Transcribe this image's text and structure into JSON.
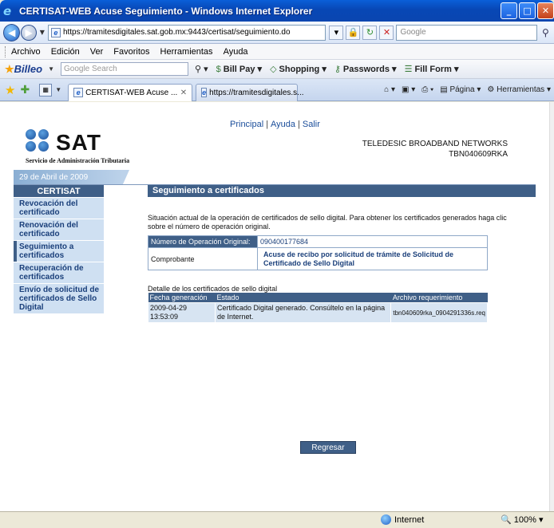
{
  "window": {
    "title": "CERTISAT-WEB Acuse Seguimiento - Windows Internet Explorer",
    "icon": "ie-icon"
  },
  "address": {
    "url": "https://tramitesdigitales.sat.gob.mx:9443/certisat/seguimiento.do",
    "search_placeholder": "Google"
  },
  "menu": [
    "Archivo",
    "Edición",
    "Ver",
    "Favoritos",
    "Herramientas",
    "Ayuda"
  ],
  "links_bar": {
    "brand": "Billeo",
    "search_placeholder": "Google Search",
    "items": [
      "Bill Pay",
      "Shopping",
      "Passwords",
      "Fill Form"
    ]
  },
  "tabs": [
    {
      "label": "CERTISAT-WEB Acuse ...",
      "active": true
    },
    {
      "label": "https://tramitesdigitales.s...",
      "active": false
    }
  ],
  "command_bar": [
    "Página",
    "Herramientas"
  ],
  "page": {
    "top_links": [
      "Principal",
      "Ayuda",
      "Salir"
    ],
    "logo_text": "SAT",
    "logo_subtitle": "Servicio de Administración Tributaria",
    "company_name": "TELEDESIC BROADBAND NETWORKS",
    "company_rfc": "TBN040609RKA",
    "date": "29 de Abril de 2009",
    "sidebar": {
      "title": "CERTISAT",
      "items": [
        {
          "label": "Revocación del certificado",
          "active": false
        },
        {
          "label": "Renovación del certificado",
          "active": false
        },
        {
          "label": "Seguimiento a certificados",
          "active": true
        },
        {
          "label": "Recuperación de certificados",
          "active": false
        },
        {
          "label": "Envío de solicitud de certificados de Sello Digital",
          "active": false
        }
      ]
    },
    "section_title": "Seguimiento a certificados",
    "intro": "Situación actual de la operación de certificados de sello digital. Para obtener los certificados generados haga clic sobre el número de operación original.",
    "operation_label": "Número de Operación Original:",
    "operation_value": "090400177684",
    "receipt_label": "Comprobante",
    "receipt_value": "Acuse de recibo por solicitud de trámite de Solicitud de Certificado de Sello Digital",
    "detail_title": "Detalle de los certificados de sello digital",
    "detail_table": {
      "headers": [
        "Fecha generación",
        "Estado",
        "Archivo requerimiento"
      ],
      "rows": [
        [
          "2009-04-29 13:53:09",
          "Certificado Digital generado. Consúltelo en la página de Internet.",
          "tbn040609rka_0904291336s.req"
        ]
      ]
    },
    "back_button": "Regresar"
  },
  "status": {
    "zone": "Internet",
    "zoom": "100%"
  },
  "colors": {
    "accent": "#3f5f87",
    "sidebar_bg": "#cfe0f2",
    "link": "#1a4d9a"
  }
}
